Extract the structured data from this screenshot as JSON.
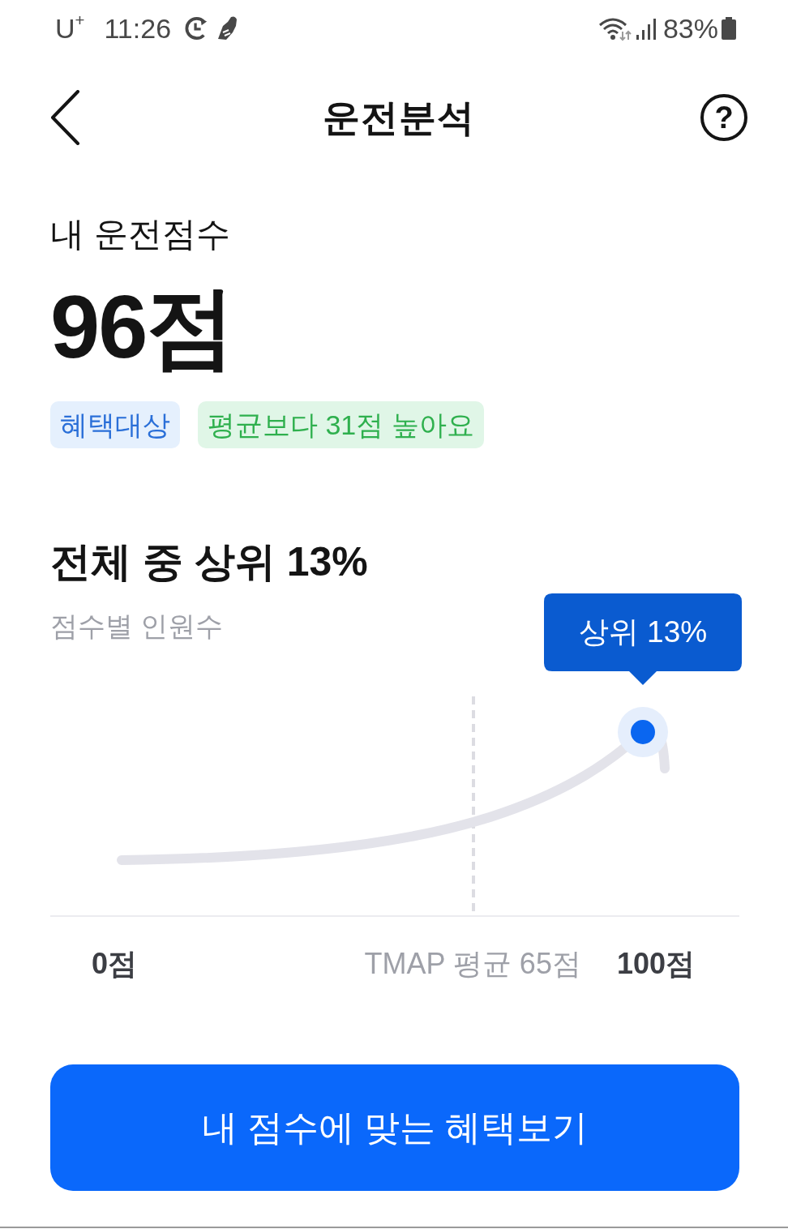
{
  "status_bar": {
    "carrier": "U$^{+}$",
    "time": "11:26",
    "battery": "83%"
  },
  "header": {
    "title": "운전분석",
    "help": "?"
  },
  "score": {
    "label": "내 운전점수",
    "value": "96점",
    "badges": [
      {
        "text": "혜택대상",
        "kind": "info"
      },
      {
        "text": "평균보다 31점 높아요",
        "kind": "positive"
      }
    ]
  },
  "ranking": {
    "title": "전체 중 상위 13%",
    "subtitle": "점수별 인원수",
    "tooltip": "상위 13%",
    "x_labels": [
      {
        "text": "0점",
        "kind": "bound"
      },
      {
        "text": "TMAP 평균 65점",
        "kind": "average"
      },
      {
        "text": "100점",
        "kind": "bound"
      }
    ]
  },
  "button": {
    "label": "내 점수에 맞는 혜택보기"
  }
}
